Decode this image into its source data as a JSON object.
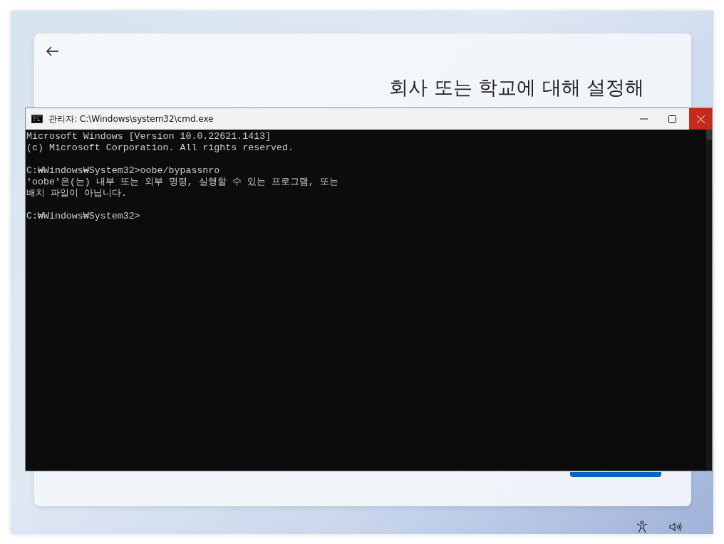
{
  "setup_page": {
    "heading": "회사 또는 학교에 대해 설정해"
  },
  "console_window": {
    "title": "관리자: C:\\Windows\\system32\\cmd.exe",
    "blocks": [
      [
        "Microsoft Windows [Version 10.0.22621.1413]",
        "(c) Microsoft Corporation. All rights reserved."
      ],
      [
        "C:₩Windows₩System32>oobe/bypassnro",
        "'oobe'은(는) 내부 또는 외부 명령, 실행할 수 있는 프로그램, 또는",
        "배치 파일이 아닙니다."
      ],
      [
        "C:₩Windows₩System32>"
      ]
    ]
  }
}
